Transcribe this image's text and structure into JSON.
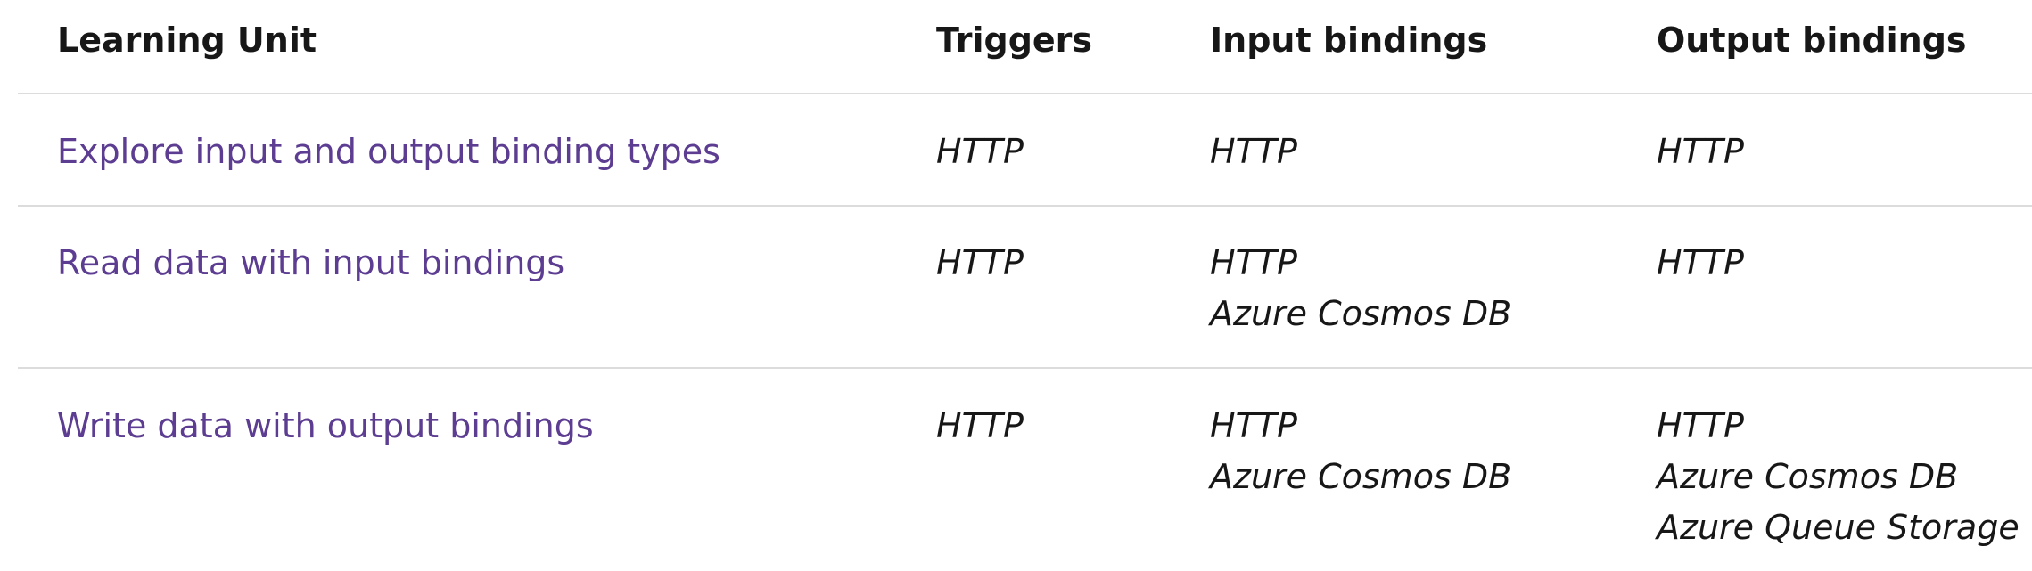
{
  "table": {
    "headers": {
      "learning_unit": "Learning Unit",
      "triggers": "Triggers",
      "input_bindings": "Input bindings",
      "output_bindings": "Output bindings"
    },
    "rows": [
      {
        "unit": "Explore input and output binding types",
        "triggers": "HTTP",
        "inputs": [
          "HTTP"
        ],
        "outputs": [
          "HTTP"
        ]
      },
      {
        "unit": "Read data with input bindings",
        "triggers": "HTTP",
        "inputs": [
          "HTTP",
          "Azure Cosmos DB"
        ],
        "outputs": [
          "HTTP"
        ]
      },
      {
        "unit": "Write data with output bindings",
        "triggers": "HTTP",
        "inputs": [
          "HTTP",
          "Azure Cosmos DB"
        ],
        "outputs": [
          "HTTP",
          "Azure Cosmos DB",
          "Azure Queue Storage"
        ]
      }
    ]
  }
}
